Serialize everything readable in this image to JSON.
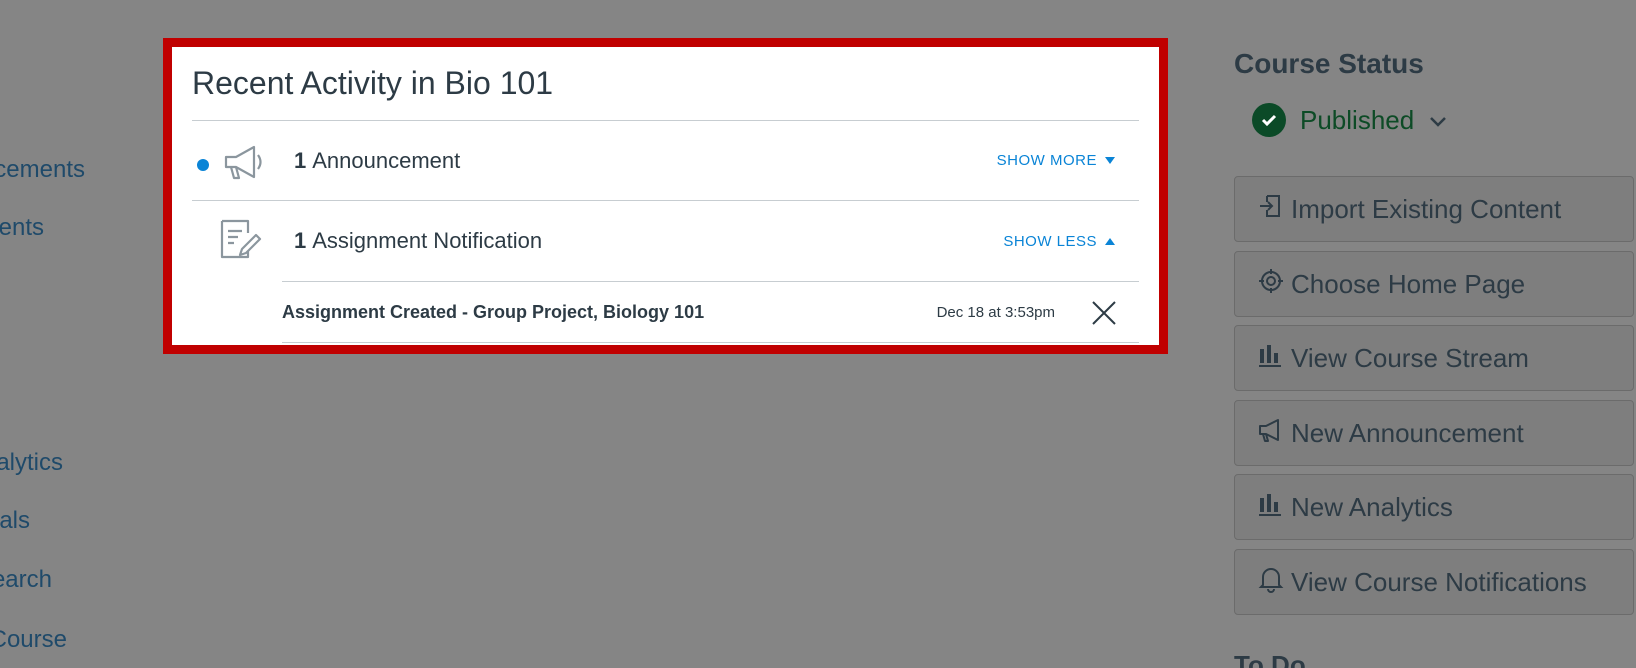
{
  "left_nav": {
    "items": [
      {
        "label": "cements"
      },
      {
        "label": "ents"
      },
      {
        "label": "alytics"
      },
      {
        "label": "als"
      },
      {
        "label": "earch"
      },
      {
        "label": "Course"
      }
    ]
  },
  "activity": {
    "title": "Recent Activity in Bio 101",
    "announcement": {
      "count": "1",
      "label": "Announcement",
      "toggle": "SHOW MORE"
    },
    "assignment": {
      "count": "1",
      "label": "Assignment Notification",
      "toggle": "SHOW LESS"
    },
    "detail": {
      "title": "Assignment Created - Group Project, Biology 101",
      "date": "Dec 18 at 3:53pm"
    }
  },
  "sidebar": {
    "title": "Course Status",
    "status": "Published",
    "buttons": [
      {
        "label": "Import Existing Content",
        "icon": "import-icon"
      },
      {
        "label": "Choose Home Page",
        "icon": "target-icon"
      },
      {
        "label": "View Course Stream",
        "icon": "bar-chart-icon"
      },
      {
        "label": "New Announcement",
        "icon": "megaphone-icon"
      },
      {
        "label": "New Analytics",
        "icon": "bar-chart-icon"
      },
      {
        "label": "View Course Notifications",
        "icon": "bell-icon"
      }
    ],
    "todo_title": "To Do"
  },
  "colors": {
    "highlight": "#c00000",
    "link": "#0a84d6",
    "published": "#0b4a27"
  }
}
